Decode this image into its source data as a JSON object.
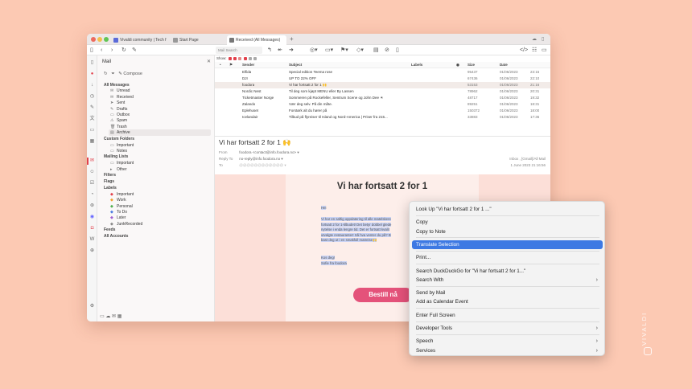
{
  "browser": {
    "tabs": [
      {
        "label": "Vivaldi community | Tech f",
        "favicon_color": "#5b6bd9"
      },
      {
        "label": "Start Page",
        "favicon_color": "#999999"
      },
      {
        "label": "Received (All Messages)",
        "favicon_color": "#777777"
      }
    ],
    "new_tab_glyph": "+",
    "search_placeholder": "Mail Search"
  },
  "mail_panel": {
    "title": "Mail",
    "compose_label": "Compose",
    "items": [
      {
        "label": "All Messages",
        "kind": "section",
        "icon": ""
      },
      {
        "label": "Unread",
        "kind": "sub",
        "icon": "✉"
      },
      {
        "label": "Received",
        "kind": "sub",
        "icon": "✉"
      },
      {
        "label": "Sent",
        "kind": "sub",
        "icon": "➤"
      },
      {
        "label": "Drafts",
        "kind": "sub",
        "icon": "✎"
      },
      {
        "label": "Outbox",
        "kind": "sub",
        "icon": "▭"
      },
      {
        "label": "Spam",
        "kind": "sub",
        "icon": "⚠"
      },
      {
        "label": "Trash",
        "kind": "sub",
        "icon": "🗑"
      },
      {
        "label": "Archive",
        "kind": "sub",
        "icon": "▤"
      },
      {
        "label": "Custom Folders",
        "kind": "section",
        "icon": ""
      },
      {
        "label": "Important",
        "kind": "sub",
        "icon": "▭"
      },
      {
        "label": "Notes",
        "kind": "sub",
        "icon": "▭"
      },
      {
        "label": "Mailing Lists",
        "kind": "section",
        "icon": ""
      },
      {
        "label": "Important",
        "kind": "sub",
        "icon": "▭"
      },
      {
        "label": "Other",
        "kind": "sub",
        "icon": "▸"
      },
      {
        "label": "Filters",
        "kind": "section",
        "icon": ""
      },
      {
        "label": "Flags",
        "kind": "section",
        "icon": ""
      },
      {
        "label": "Labels",
        "kind": "section",
        "icon": ""
      },
      {
        "label": "Important",
        "kind": "sub",
        "icon": "◆",
        "color": "#e2404b"
      },
      {
        "label": "Work",
        "kind": "sub",
        "icon": "◆",
        "color": "#f0a030"
      },
      {
        "label": "Personal",
        "kind": "sub",
        "icon": "◆",
        "color": "#50b050"
      },
      {
        "label": "To Do",
        "kind": "sub",
        "icon": "◆",
        "color": "#4a7be0"
      },
      {
        "label": "Later",
        "kind": "sub",
        "icon": "◆",
        "color": "#a060d0"
      },
      {
        "label": "JunkRecorded",
        "kind": "sub",
        "icon": "◆",
        "color": "#888888"
      },
      {
        "label": "Feeds",
        "kind": "section",
        "icon": ""
      },
      {
        "label": "All Accounts",
        "kind": "section",
        "icon": ""
      }
    ]
  },
  "list": {
    "show_label": "Show:",
    "columns": {
      "sender": "Sender",
      "subject": "Subject",
      "labels": "Labels",
      "size": "Size",
      "date": "Date"
    },
    "rows": [
      {
        "sender": "Elfida",
        "subject": "Special edition Teema rose",
        "size": "95437",
        "date": "01/06/2023",
        "time": "23:15"
      },
      {
        "sender": "DJI",
        "subject": "UP TO 22% OFF",
        "size": "67436",
        "date": "01/06/2023",
        "time": "22:10"
      },
      {
        "sender": "foodora",
        "subject": "Vi har fortsatt 2 for 1 🙌",
        "size": "53153",
        "date": "01/06/2023",
        "time": "21:16",
        "selected": true
      },
      {
        "sender": "Nordic Nest",
        "subject": "Til deg som kjøpt MENU eller By Lassen",
        "size": "78962",
        "date": "01/06/2023",
        "time": "20:31"
      },
      {
        "sender": "Ticketmaster Norge",
        "subject": "Sommeren på Rockefeller, Sentrum Scene og John Dee ☀",
        "size": "48717",
        "date": "01/06/2023",
        "time": "19:32"
      },
      {
        "sender": "Zalando",
        "subject": "Vær deg selv. På din måte.",
        "size": "89251",
        "date": "01/06/2023",
        "time": "18:31"
      },
      {
        "sender": "Eplehuset",
        "subject": "Forstørk alt du hører på",
        "size": "150372",
        "date": "01/06/2023",
        "time": "18:00"
      },
      {
        "sender": "Icelandair",
        "subject": "Tilbud på flyreiser til Island og Nord-America | Priser fra 215...",
        "size": "33883",
        "date": "01/06/2023",
        "time": "17:36"
      }
    ]
  },
  "message": {
    "subject": "Vi har fortsatt 2 for 1 🙌",
    "from_label": "From",
    "from_value": "foodora <contact@info.foodora.no> ▾",
    "reply_label": "Reply To",
    "reply_value": "no-reply@info.foodora.no ▾",
    "to_label": "To",
    "to_value": "@@@@@@@@@@@@ ▾",
    "folder": "Inbox , [Gmail]/All Mail",
    "received": "1 June 2023 21:16:56",
    "headline": "Vi har fortsatt 2 for 1",
    "greeting": "Hei",
    "body_lines": [
      "Vi har en saftig oppdatering til alle matelskere",
      "fortsatt 2 for 1-tilbudet! Det betyr dobbel glede",
      "nytelse i enda lengre tid. Det er fortsatt kvalit",
      "utvalgte restauranter! Så hva venter du på? B",
      "bast deg ut i en smakfull matreise🙌"
    ],
    "signoff": "Kos deg!",
    "signature": "Sofie fra foodora",
    "cta": "Bestill nå"
  },
  "context_menu": {
    "items": [
      {
        "label": "Look Up \"Vi har fortsatt 2 for 1 ...\"",
        "submenu": false
      },
      {
        "label": "Copy",
        "submenu": false
      },
      {
        "label": "Copy to Note",
        "submenu": false
      },
      {
        "label": "Translate Selection",
        "submenu": false,
        "highlighted": true
      },
      {
        "label": "Print...",
        "submenu": false
      },
      {
        "label": "Search DuckDuckGo for \"Vi har fortsatt 2 for 1...\"",
        "submenu": false
      },
      {
        "label": "Search With",
        "submenu": true
      },
      {
        "label": "Send by Mail",
        "submenu": false
      },
      {
        "label": "Add as Calendar Event",
        "submenu": false
      },
      {
        "label": "Enter Full Screen",
        "submenu": false
      },
      {
        "label": "Developer Tools",
        "submenu": true
      },
      {
        "label": "Speech",
        "submenu": true
      },
      {
        "label": "Services",
        "submenu": true
      }
    ],
    "highlight_color": "#3d79e3"
  },
  "branding": {
    "text": "VIVALDI"
  }
}
